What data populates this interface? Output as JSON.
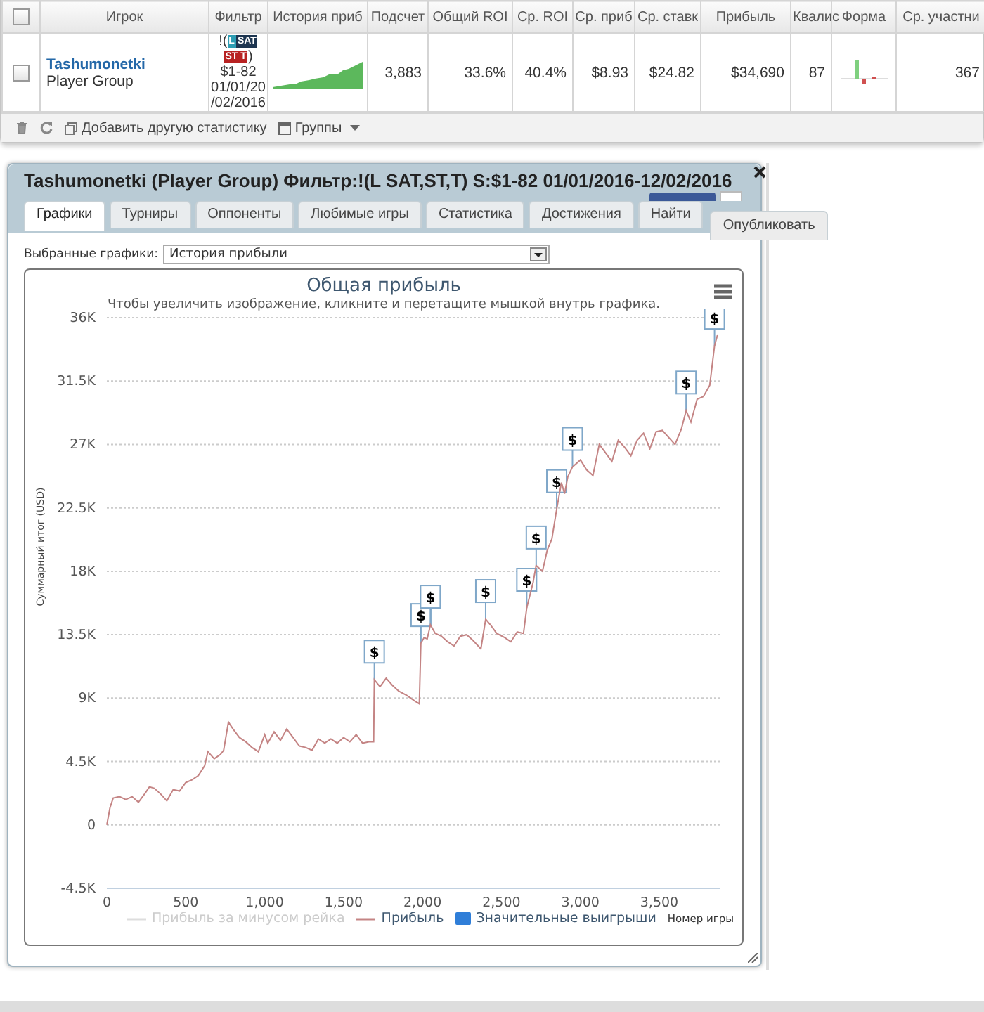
{
  "stats_panel": {
    "header_checkbox": {
      "checked": false
    },
    "columns": [
      "Игрок",
      "Фильтр",
      "История приб",
      "Подсчет",
      "Общий ROI",
      "Ср. ROI",
      "Ср. приб",
      "Ср. ставк",
      "Прибыль",
      "Квалис",
      "Форма",
      "Ср. участни"
    ],
    "rows": [
      {
        "checked": false,
        "cells": [
          {
            "kind": "player",
            "name": "Tashumonetki",
            "group": "Player Group"
          },
          {
            "kind": "filter",
            "prefix": "!(",
            "tags": [
              {
                "text": "L",
                "color": "#2d9db3"
              },
              {
                "text": "SAT",
                "color": "#1d3550"
              },
              {
                "text": "ST",
                "color": "#b82222"
              },
              {
                "text": "T",
                "color": "#b82222"
              }
            ],
            "suffix": ")",
            "lines": [
              "$1-82",
              "01/01/20",
              "/02/2016"
            ]
          },
          {
            "kind": "sparkline"
          },
          {
            "kind": "text",
            "text": "3,883"
          },
          {
            "kind": "text",
            "text": "33.6%"
          },
          {
            "kind": "text",
            "text": "40.4%"
          },
          {
            "kind": "text",
            "text": "$8.93"
          },
          {
            "kind": "text",
            "text": "$24.82"
          },
          {
            "kind": "text",
            "text": "$34,690"
          },
          {
            "kind": "text",
            "text": "87"
          },
          {
            "kind": "form"
          },
          {
            "kind": "text",
            "text": "367"
          }
        ]
      }
    ],
    "toolbar": [
      {
        "label": "Добавить другую статистику",
        "dropdown": false
      },
      {
        "label": "Группы",
        "dropdown": true
      }
    ]
  },
  "dialog": {
    "title": "Tashumonetki (Player Group) Фильтр:!(L SAT,ST,T) S:$1-82 01/01/2016-12/02/2016",
    "tabs": [
      {
        "label": "Графики",
        "selected": true
      },
      {
        "label": "Турниры",
        "selected": false
      },
      {
        "label": "Оппоненты",
        "selected": false
      },
      {
        "label": "Любимые игры",
        "selected": false
      },
      {
        "label": "Статистика",
        "selected": false
      },
      {
        "label": "Достижения",
        "selected": false
      },
      {
        "label": "Найти",
        "selected": false
      }
    ],
    "publish_button": "Опубликовать",
    "chart_selector": {
      "label": "Выбранные графики:",
      "value": "История прибыли"
    },
    "chart": {
      "subtitle": "Чтобы увеличить изображение, кликните и перетащите мышкой внутрь графика.",
      "chart_data": {
        "type": "line",
        "title": "Общая прибыль",
        "xlabel": "Номер игры",
        "ylabel": "Суммарный итог (USD)",
        "x": [
          0,
          20,
          40,
          80,
          120,
          160,
          200,
          240,
          270,
          300,
          340,
          380,
          420,
          460,
          500,
          540,
          580,
          620,
          640,
          680,
          720,
          740,
          770,
          800,
          840,
          880,
          920,
          960,
          1000,
          1020,
          1060,
          1100,
          1140,
          1180,
          1220,
          1260,
          1300,
          1340,
          1380,
          1420,
          1460,
          1500,
          1540,
          1580,
          1620,
          1660,
          1690,
          1695,
          1730,
          1770,
          1810,
          1850,
          1900,
          1950,
          1980,
          1990,
          2010,
          2030,
          2050,
          2080,
          2120,
          2160,
          2200,
          2240,
          2280,
          2320,
          2370,
          2400,
          2430,
          2470,
          2520,
          2560,
          2600,
          2640,
          2660,
          2700,
          2720,
          2760,
          2790,
          2820,
          2850,
          2880,
          2900,
          2920,
          2950,
          3000,
          3040,
          3080,
          3120,
          3160,
          3200,
          3240,
          3280,
          3320,
          3360,
          3400,
          3440,
          3480,
          3520,
          3560,
          3600,
          3640,
          3670,
          3700,
          3740,
          3780,
          3820,
          3850,
          3870
        ],
        "series": [
          {
            "name": "Прибыль",
            "color": "#c48484",
            "values": [
              0,
              1200,
              1900,
              2000,
              1800,
              2000,
              1600,
              2200,
              2700,
              2600,
              2200,
              1700,
              2500,
              2400,
              3000,
              3200,
              3500,
              4200,
              5200,
              4700,
              5000,
              5300,
              7300,
              6800,
              6200,
              5900,
              5500,
              5200,
              6400,
              5800,
              6600,
              6000,
              6800,
              6200,
              5600,
              5500,
              5300,
              6100,
              5800,
              6100,
              5800,
              6200,
              5900,
              6400,
              5800,
              5900,
              5900,
              10300,
              9800,
              10400,
              9900,
              9500,
              9200,
              8800,
              8600,
              12900,
              13300,
              13200,
              14200,
              13600,
              13400,
              13000,
              12700,
              13400,
              13500,
              13100,
              12500,
              14600,
              14200,
              13600,
              13300,
              13000,
              13700,
              13600,
              15400,
              17200,
              18400,
              18000,
              19500,
              20300,
              22400,
              24300,
              23500,
              24700,
              25400,
              25900,
              25200,
              24800,
              27000,
              26400,
              25800,
              27300,
              26800,
              26200,
              27300,
              27800,
              26700,
              27900,
              28000,
              27500,
              27000,
              28100,
              29400,
              28600,
              30200,
              30400,
              31200,
              34000,
              34800
            ]
          }
        ],
        "xlim": [
          0,
          3883
        ],
        "ylim": [
          -4500,
          36000
        ],
        "grid": true,
        "xticks": [
          {
            "value": 0,
            "label": "0"
          },
          {
            "value": 500,
            "label": "500"
          },
          {
            "value": 1000,
            "label": "1,000"
          },
          {
            "value": 1500,
            "label": "1,500"
          },
          {
            "value": 2000,
            "label": "2,000"
          },
          {
            "value": 2500,
            "label": "2,500"
          },
          {
            "value": 3000,
            "label": "3,000"
          },
          {
            "value": 3500,
            "label": "3,500"
          }
        ],
        "yticks": [
          {
            "value": -4500,
            "label": "-4.5K"
          },
          {
            "value": 0,
            "label": "0"
          },
          {
            "value": 4500,
            "label": "4.5K"
          },
          {
            "value": 9000,
            "label": "9K"
          },
          {
            "value": 13500,
            "label": "13.5K"
          },
          {
            "value": 18000,
            "label": "18K"
          },
          {
            "value": 22500,
            "label": "22.5K"
          },
          {
            "value": 27000,
            "label": "27K"
          },
          {
            "value": 31500,
            "label": "31.5K"
          },
          {
            "value": 36000,
            "label": "36K"
          }
        ],
        "annotations": [
          {
            "x": 1695,
            "y": 10300,
            "text": "$"
          },
          {
            "x": 1990,
            "y": 12900,
            "text": "$"
          },
          {
            "x": 2050,
            "y": 14200,
            "text": "$"
          },
          {
            "x": 2400,
            "y": 14600,
            "text": "$"
          },
          {
            "x": 2660,
            "y": 15400,
            "text": "$"
          },
          {
            "x": 2720,
            "y": 18400,
            "text": "$"
          },
          {
            "x": 2850,
            "y": 22400,
            "text": "$"
          },
          {
            "x": 2950,
            "y": 25400,
            "text": "$"
          },
          {
            "x": 3670,
            "y": 29400,
            "text": "$"
          },
          {
            "x": 3850,
            "y": 34000,
            "text": "$"
          }
        ]
      },
      "legend": [
        {
          "label": "Прибыль за минусом рейка",
          "kind": "line",
          "visible": false
        },
        {
          "kind": "series",
          "visible": true
        },
        {
          "label": "Значительные выигрыши",
          "kind": "flag",
          "visible": true,
          "color": "#2f7ed8"
        }
      ]
    }
  }
}
